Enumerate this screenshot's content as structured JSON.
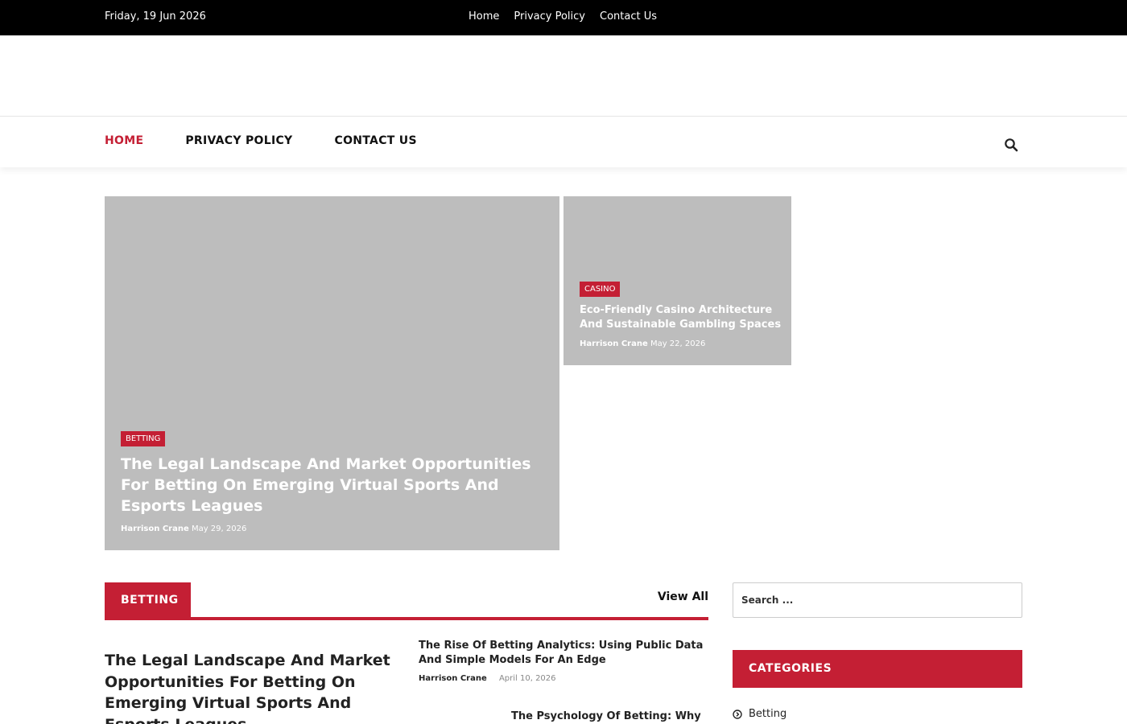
{
  "topbar": {
    "date": "Friday, 19 Jun 2026",
    "links": [
      "Home",
      "Privacy Policy",
      "Contact Us"
    ]
  },
  "nav": {
    "items": [
      "HOME",
      "PRIVACY POLICY",
      "CONTACT US"
    ],
    "active_color": "#c41f34"
  },
  "hero": {
    "main": {
      "category": "BETTING",
      "title": "The Legal Landscape And Market Opportunities For Betting On Emerging Virtual Sports And Esports Leagues",
      "author": "Harrison Crane",
      "date": "May 29, 2026"
    },
    "side": {
      "category": "CASINO",
      "title": "Eco-Friendly Casino Architecture And Sustainable Gambling Spaces",
      "author": "Harrison Crane",
      "date": "May 22, 2026"
    }
  },
  "betting_section": {
    "heading": "BETTING",
    "view_all": "View All",
    "big_article_title": "The Legal Landscape And Market Opportunities For Betting On Emerging Virtual Sports And Esports Leagues",
    "small_articles": [
      {
        "title": "The Rise Of Betting Analytics: Using Public Data And Simple Models For An Edge",
        "author": "Harrison Crane",
        "date": "April 10, 2026"
      },
      {
        "title": "The Psychology Of Betting: Why"
      }
    ]
  },
  "sidebar": {
    "search_placeholder": "Search ...",
    "categories_heading": "CATEGORIES",
    "categories": [
      "Betting"
    ]
  },
  "colors": {
    "brand_red": "#c41f34",
    "topbar_bg": "#000000",
    "image_placeholder": "#bdbdbd"
  }
}
